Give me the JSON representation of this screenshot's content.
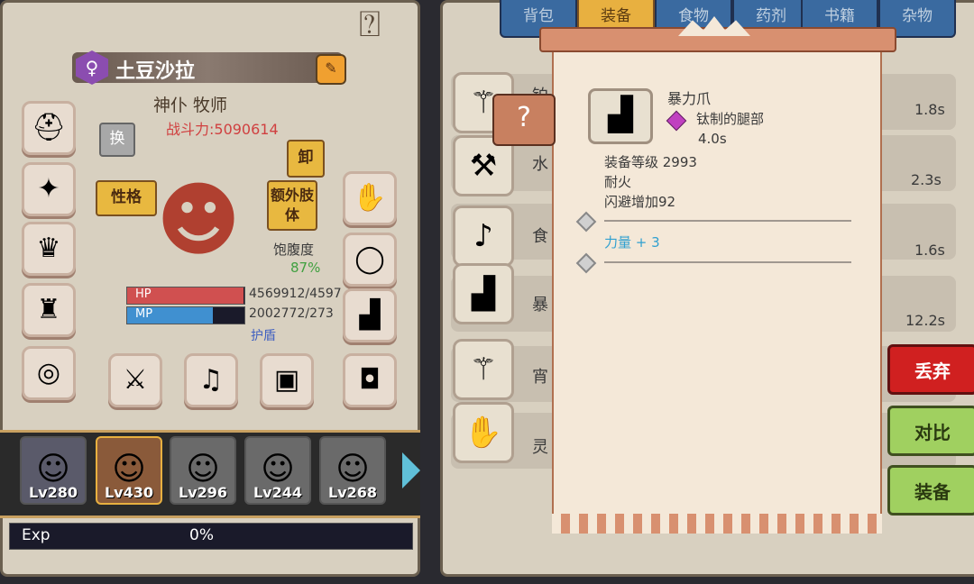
{
  "character": {
    "name": "土豆沙拉",
    "class": "神仆 牧师",
    "power": "战斗力:5090614",
    "swap_label": "换",
    "unequip_label": "卸",
    "trait_label": "性格",
    "extra_label": "额外肢体",
    "hunger_label": "饱腹度",
    "hunger_value": "87%",
    "hp_label": "HP",
    "hp_value": "4569912/4597",
    "hp_fraction": 0.99,
    "mp_label": "MP",
    "mp_value": "2002772/273",
    "mp_fraction": 0.73,
    "shield_label": "护盾"
  },
  "heroes": [
    {
      "level": "Lv280",
      "selected": false
    },
    {
      "level": "Lv430",
      "selected": true
    },
    {
      "level": "Lv296",
      "selected": false
    },
    {
      "level": "Lv244",
      "selected": false
    },
    {
      "level": "Lv268",
      "selected": false
    }
  ],
  "exp": {
    "label": "Exp",
    "value": "0%"
  },
  "tabs": [
    "背包",
    "装备",
    "食物",
    "药剂",
    "书籍",
    "杂物"
  ],
  "active_tab": "装备",
  "inventory": [
    {
      "name": "铂",
      "time": "1.8s"
    },
    {
      "name": "水",
      "time": "2.3s"
    },
    {
      "name": "食",
      "time": "1.6s"
    },
    {
      "name": "暴",
      "time": "12.2s"
    },
    {
      "name": "宵",
      "time": ""
    },
    {
      "name": "灵",
      "time": ""
    }
  ],
  "tooltip": {
    "badge": "?",
    "title": "暴力爪",
    "subtitle": "钛制的腿部",
    "speed": "4.0s",
    "level": "装备等级 2993",
    "trait1": "耐火",
    "trait2": "闪避增加92",
    "bonus": "力量 + 3"
  },
  "actions": {
    "discard": "丢弃",
    "compare": "对比",
    "equip": "装备"
  }
}
